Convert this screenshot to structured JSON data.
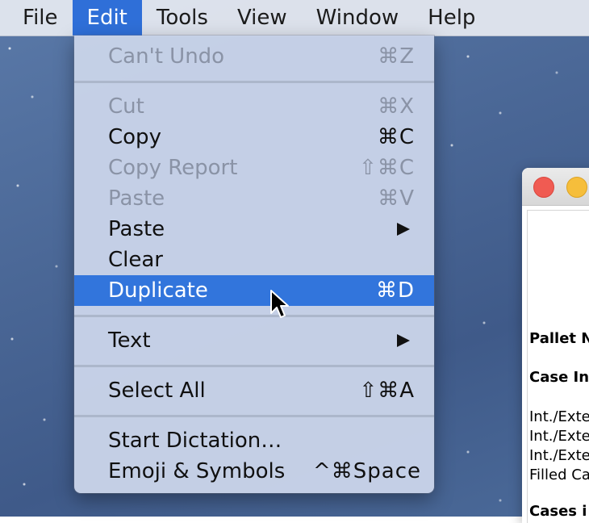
{
  "menubar": {
    "items": [
      {
        "label": "File"
      },
      {
        "label": "Edit"
      },
      {
        "label": "Tools"
      },
      {
        "label": "View"
      },
      {
        "label": "Window"
      },
      {
        "label": "Help"
      }
    ],
    "active": "Edit"
  },
  "edit_menu": {
    "items": [
      {
        "label": "Can't Undo",
        "shortcut": "⌘Z",
        "enabled": false
      },
      {
        "label": "Cut",
        "shortcut": "⌘X",
        "enabled": false
      },
      {
        "label": "Copy",
        "shortcut": "⌘C",
        "enabled": true
      },
      {
        "label": "Copy Report",
        "shortcut": "⇧⌘C",
        "enabled": false
      },
      {
        "label": "Paste",
        "shortcut": "⌘V",
        "enabled": false
      },
      {
        "label": "Paste",
        "shortcut": "",
        "enabled": true,
        "submenu": true
      },
      {
        "label": "Clear",
        "shortcut": "",
        "enabled": true
      },
      {
        "label": "Duplicate",
        "shortcut": "⌘D",
        "enabled": true,
        "highlighted": true
      },
      {
        "label": "Text",
        "shortcut": "",
        "enabled": true,
        "submenu": true
      },
      {
        "label": "Select All",
        "shortcut": "⇧⌘A",
        "enabled": true
      },
      {
        "label": "Start Dictation…",
        "shortcut": "",
        "enabled": true
      },
      {
        "label": "Emoji & Symbols",
        "shortcut": "^⌘Space",
        "enabled": true
      }
    ]
  },
  "document": {
    "lines": [
      {
        "text": "Pallet N",
        "bold": true
      },
      {
        "text": "Case In",
        "bold": true
      },
      {
        "text": "Int./Exte",
        "bold": false
      },
      {
        "text": "Int./Exte",
        "bold": false
      },
      {
        "text": "Int./Exte",
        "bold": false
      },
      {
        "text": "Filled Ca",
        "bold": false
      },
      {
        "text": "Cases i",
        "bold": true
      }
    ]
  },
  "colors": {
    "highlight": "#3275dc",
    "active_menubar": "#2f6fd8",
    "disabled_text": "#8a93a6"
  },
  "icons": {
    "cursor": "arrow-pointer-icon",
    "submenu": "triangle-right-icon"
  }
}
